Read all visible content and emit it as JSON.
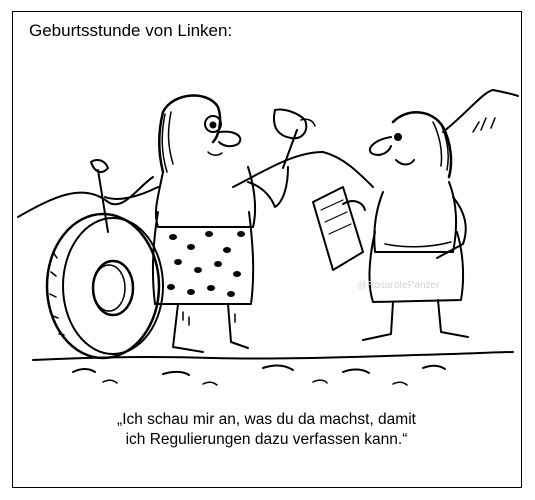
{
  "panel": {
    "title": "Geburtsstunde von Linken:",
    "caption_lines": [
      "„Ich schau mir an, was du da machst, damit",
      "ich Regulierungen dazu verfassen kann.“"
    ],
    "watermark": "@RosarotePanzer"
  },
  "colors": {
    "ink": "#000000",
    "paper": "#ffffff",
    "watermark": "#d4d4d4"
  }
}
